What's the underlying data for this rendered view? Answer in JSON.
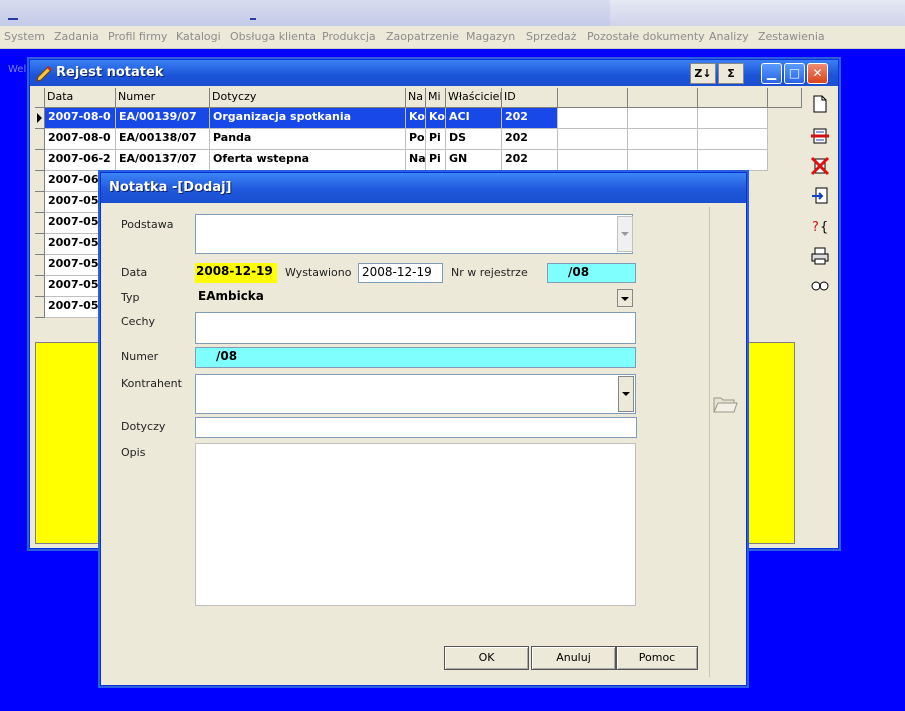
{
  "menu": [
    "System",
    "Zadania",
    "Profil firmy",
    "Katalogi",
    "Obsługa klienta",
    "Produkcja",
    "Zaopatrzenie",
    "Magazyn",
    "Sprzedaż",
    "Pozostałe dokumenty",
    "Analizy",
    "Zestawienia"
  ],
  "bg_label": "Wel",
  "window": {
    "title": "Rejest notatek",
    "sort_button": "Z↓",
    "sum_button": "Σ",
    "columns": [
      "Data",
      "Numer",
      "Dotyczy",
      "Na",
      "Mi",
      "Właściciel",
      "ID"
    ],
    "rows": [
      {
        "data": "2007-08-0",
        "numer": "EA/00139/07",
        "dotyczy": "Organizacja spotkania",
        "na": "Ko",
        "mi": "Ko",
        "wlasciciel": "ACI",
        "id": "202"
      },
      {
        "data": "2007-08-0",
        "numer": "EA/00138/07",
        "dotyczy": "Panda",
        "na": "Po",
        "mi": "Pi",
        "wlasciciel": "DS",
        "id": "202"
      },
      {
        "data": "2007-06-2",
        "numer": "EA/00137/07",
        "dotyczy": "Oferta wstepna",
        "na": "Na",
        "mi": "Pi",
        "wlasciciel": "GN",
        "id": "202"
      },
      {
        "data": "2007-06"
      },
      {
        "data": "2007-05"
      },
      {
        "data": "2007-05"
      },
      {
        "data": "2007-05"
      },
      {
        "data": "2007-05"
      },
      {
        "data": "2007-05"
      },
      {
        "data": "2007-05"
      }
    ]
  },
  "dialog": {
    "title": "Notatka -[Dodaj]",
    "labels": {
      "podstawa": "Podstawa",
      "data": "Data",
      "wystawiono": "Wystawiono",
      "nr_rejestrze": "Nr w rejestrze",
      "typ": "Typ",
      "cechy": "Cechy",
      "numer": "Numer",
      "kontrahent": "Kontrahent",
      "dotyczy": "Dotyczy",
      "opis": "Opis"
    },
    "values": {
      "data": "2008-12-19",
      "wystawiono": "2008-12-19",
      "nr_rejestrze": "/08",
      "typ": "EAmbicka",
      "numer": "/08",
      "podstawa": "",
      "cechy": "",
      "kontrahent": "",
      "dotyczy": "",
      "opis": ""
    },
    "buttons": {
      "ok": "OK",
      "anuluj": "Anuluj",
      "pomoc": "Pomoc"
    }
  },
  "colors": {
    "desktop": "#0000ff",
    "titlebar": "#1f58dc",
    "selection": "#1948e8",
    "highlight_yellow": "#ffff00",
    "highlight_cyan": "#80ffff"
  }
}
